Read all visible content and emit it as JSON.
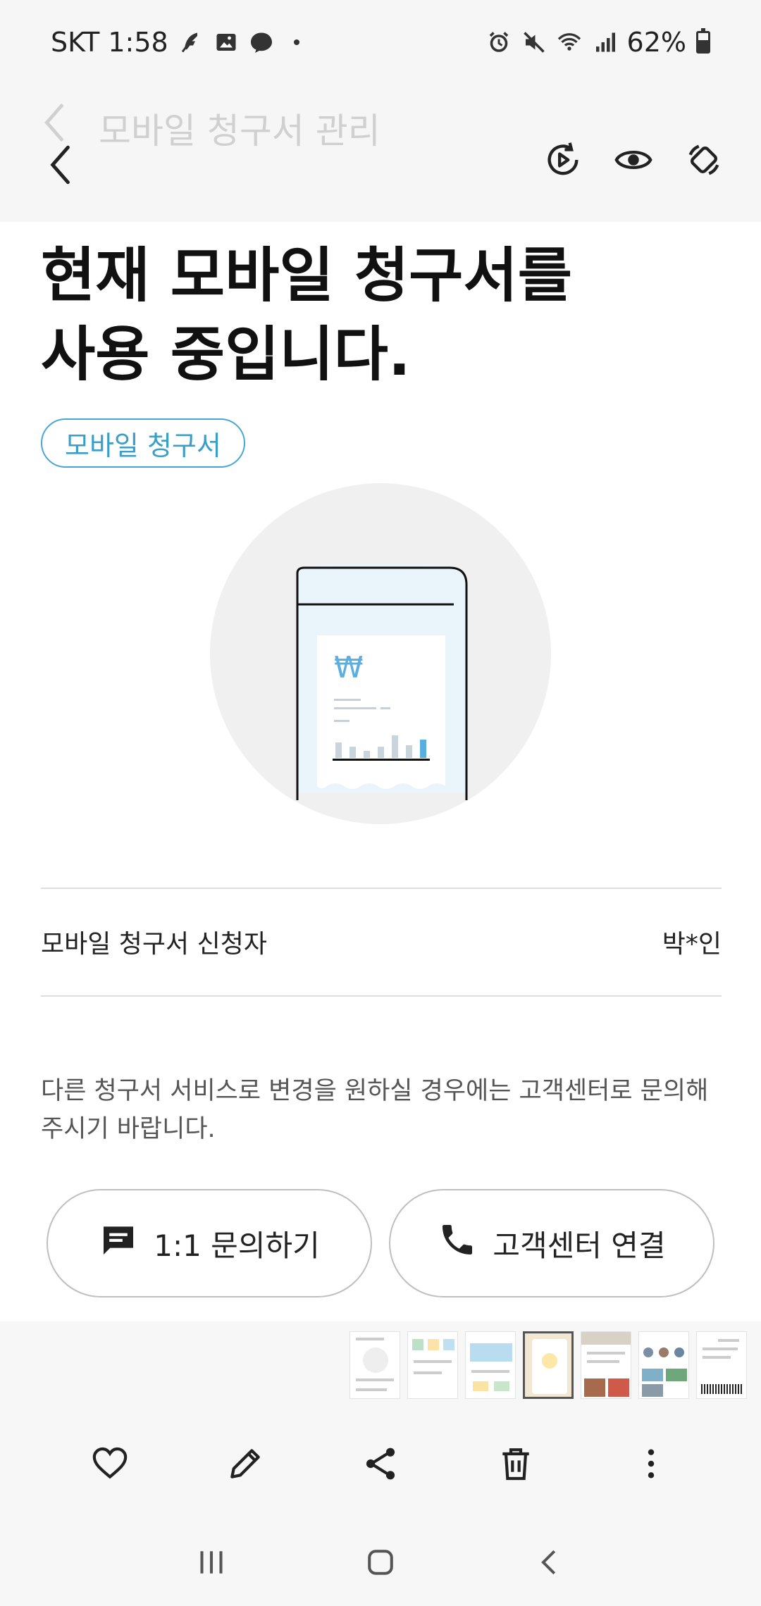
{
  "status_bar": {
    "carrier_time": "SKT 1:58",
    "battery": "62%"
  },
  "header": {
    "ghost_title": "모바일 청구서 관리",
    "icons": [
      "back-icon",
      "replay-icon",
      "eye-icon",
      "rotate-icon"
    ]
  },
  "main": {
    "headline_line1": "현재 모바일 청구서를",
    "headline_line2": "사용 중입니다.",
    "chip_label": "모바일 청구서",
    "currency_symbol": "₩",
    "applicant_label": "모바일 청구서 신청자",
    "applicant_value": "박*인",
    "notice": "다른 청구서 서비스로 변경을 원하실 경우에는 고객센터로 문의해 주시기 바랍니다.",
    "inquiry_button": "1:1 문의하기",
    "call_button": "고객센터 연결"
  },
  "colors": {
    "accent": "#3b9ec9",
    "illustration_circle": "#f0f0f0",
    "illustration_screen": "#eaf4fb"
  }
}
